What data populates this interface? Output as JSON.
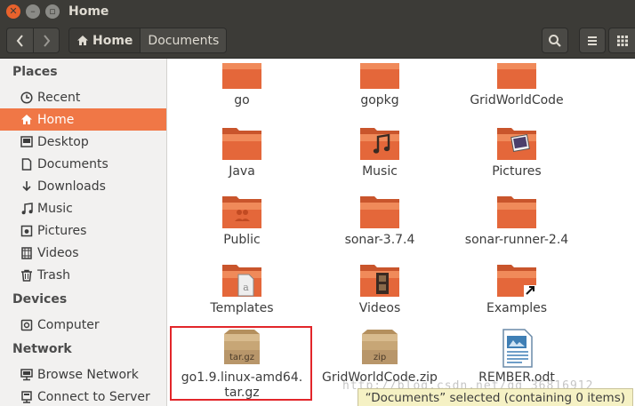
{
  "window": {
    "title": "Home"
  },
  "toolbar": {
    "back_icon": "chevron-left-icon",
    "forward_icon": "chevron-right-icon",
    "breadcrumbs": [
      {
        "label": "Home",
        "icon": "home-icon",
        "active": true
      },
      {
        "label": "Documents",
        "active": false
      }
    ],
    "search_icon": "search-icon",
    "list_view_icon": "list-icon",
    "grid_view_icon": "grid-icon"
  },
  "sidebar": {
    "sections": [
      {
        "title": "Places",
        "items": [
          {
            "label": "Recent",
            "icon": "clock-icon"
          },
          {
            "label": "Home",
            "icon": "home-icon",
            "selected": true
          },
          {
            "label": "Desktop",
            "icon": "desktop-folder-icon"
          },
          {
            "label": "Documents",
            "icon": "document-icon"
          },
          {
            "label": "Downloads",
            "icon": "download-icon"
          },
          {
            "label": "Music",
            "icon": "music-icon"
          },
          {
            "label": "Pictures",
            "icon": "camera-icon"
          },
          {
            "label": "Videos",
            "icon": "film-icon"
          },
          {
            "label": "Trash",
            "icon": "trash-icon"
          }
        ]
      },
      {
        "title": "Devices",
        "items": [
          {
            "label": "Computer",
            "icon": "drive-icon"
          }
        ]
      },
      {
        "title": "Network",
        "items": [
          {
            "label": "Browse Network",
            "icon": "network-icon"
          },
          {
            "label": "Connect to Server",
            "icon": "server-icon"
          }
        ]
      }
    ]
  },
  "files": [
    {
      "name": "go",
      "type": "folder"
    },
    {
      "name": "gopkg",
      "type": "folder"
    },
    {
      "name": "GridWorldCode",
      "type": "folder"
    },
    {
      "name": "Java",
      "type": "folder"
    },
    {
      "name": "Music",
      "type": "folder-music"
    },
    {
      "name": "Pictures",
      "type": "folder-pictures"
    },
    {
      "name": "Public",
      "type": "folder-public"
    },
    {
      "name": "sonar-3.7.4",
      "type": "folder"
    },
    {
      "name": "sonar-runner-2.4",
      "type": "folder"
    },
    {
      "name": "Templates",
      "type": "folder-templates"
    },
    {
      "name": "Videos",
      "type": "folder-videos"
    },
    {
      "name": "Examples",
      "type": "folder-link"
    },
    {
      "name": "go1.9.linux-amd64.tar.gz",
      "type": "archive",
      "archive_label": "tar.gz",
      "name_line1": "go1.9.linux-amd64.",
      "name_line2": "tar.gz"
    },
    {
      "name": "GridWorldCode.zip",
      "type": "archive",
      "archive_label": "zip"
    },
    {
      "name": "REMBER.odt",
      "type": "writer-document"
    }
  ],
  "status": "“Documents” selected (containing 0 items)",
  "watermark": "http://blog.csdn.net/qq_36816912",
  "colors": {
    "accent": "#f07746",
    "titlebar": "#3c3b37",
    "folder": "#e4673a",
    "highlight_box": "#e2262a"
  }
}
